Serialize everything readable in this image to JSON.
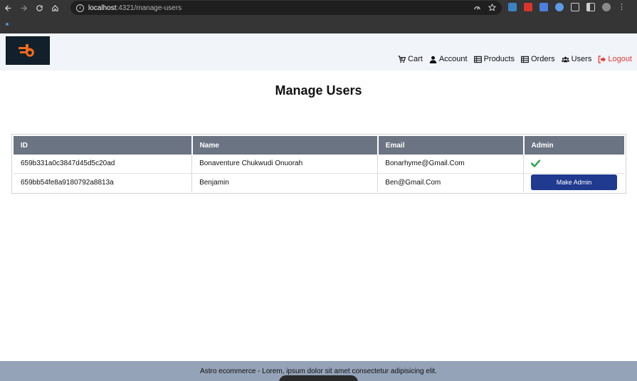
{
  "browser": {
    "url_host": "localhost",
    "url_path": ":4321/manage-users"
  },
  "nav": {
    "cart": "Cart",
    "account": "Account",
    "products": "Products",
    "orders": "Orders",
    "users": "Users",
    "logout": "Logout"
  },
  "page": {
    "title": "Manage Users"
  },
  "table": {
    "headers": [
      "ID",
      "Name",
      "Email",
      "Admin"
    ],
    "rows": [
      {
        "id": "659b331a0c3847d45d5c20ad",
        "name": "Bonaventure Chukwudi Onuorah",
        "email": "Bonarhyme@Gmail.Com",
        "admin": true
      },
      {
        "id": "659bb54fe8a9180792a8813a",
        "name": "Benjamin",
        "email": "Ben@Gmail.Com",
        "admin": false
      }
    ],
    "make_admin_label": "Make Admin"
  },
  "footer": {
    "text": "Astro ecommerce - Lorem, ipsum dolor sit amet consectetur adipisicing elit."
  },
  "colors": {
    "header_bg": "#f1f4f9",
    "table_header": "#6b7482",
    "button": "#1f3a8f",
    "logout": "#e53935",
    "check": "#22a34a",
    "footer_bg": "#94a3b8",
    "logo_accent": "#f26a1b"
  }
}
